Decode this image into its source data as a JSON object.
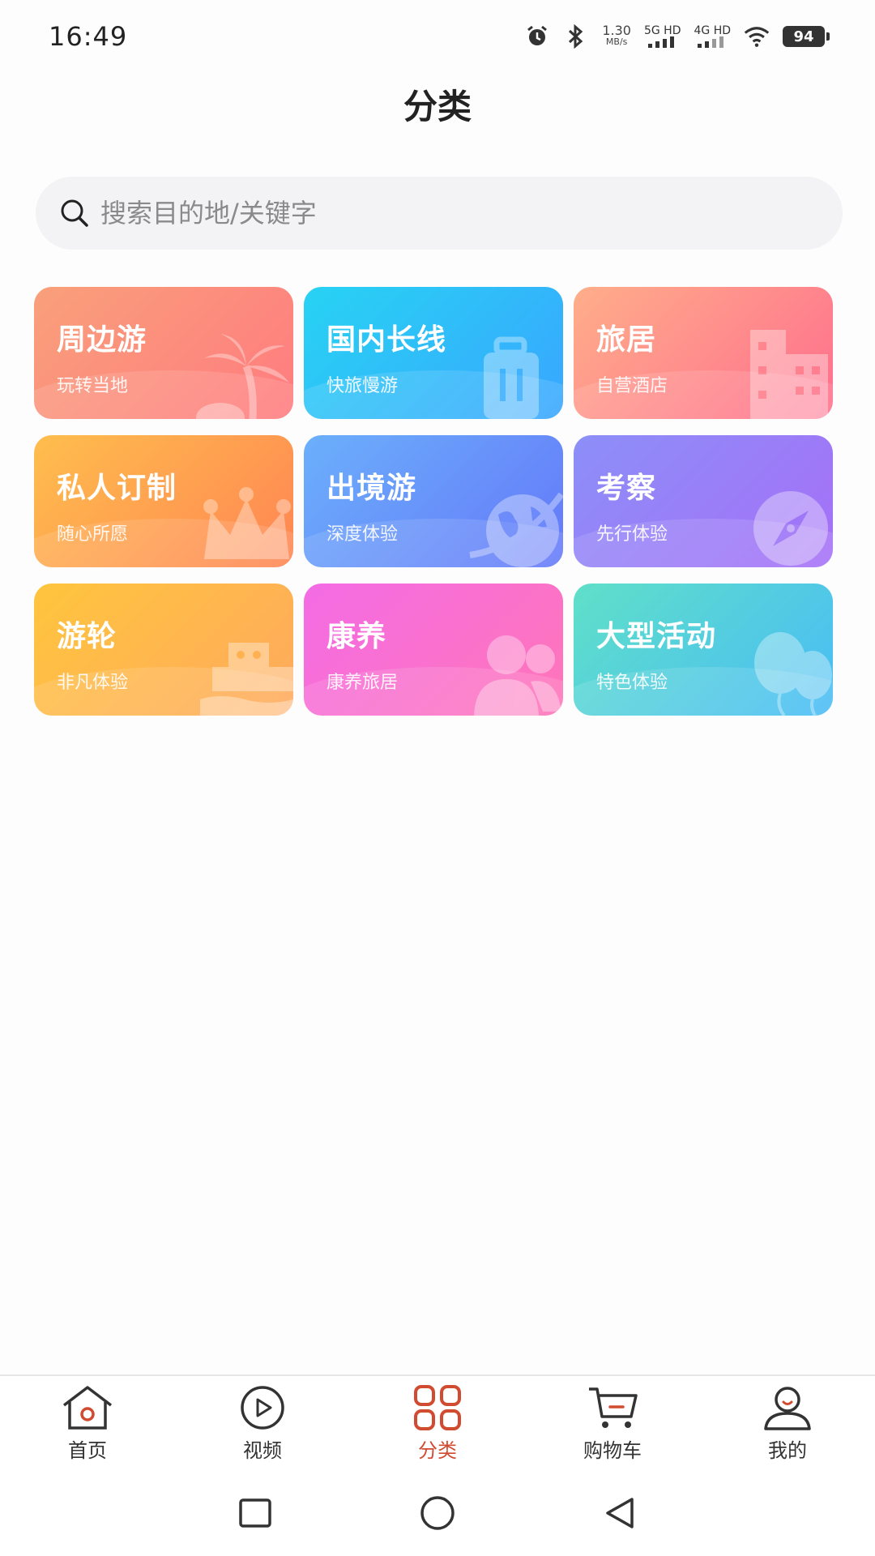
{
  "status_bar": {
    "time": "16:49",
    "net_speed_value": "1.30",
    "net_speed_unit": "MB/s",
    "sim1": "5G HD",
    "sim2": "4G HD",
    "battery": "94",
    "icons": [
      "alarm-icon",
      "bluetooth-icon",
      "signal-icon",
      "wifi-icon",
      "battery-icon"
    ]
  },
  "header": {
    "title": "分类"
  },
  "search": {
    "placeholder": "搜索目的地/关键字",
    "value": ""
  },
  "categories": [
    {
      "title": "周边游",
      "subtitle": "玩转当地",
      "icon": "palm-tree-icon",
      "colors": [
        "#f9a07a",
        "#ff7b80"
      ]
    },
    {
      "title": "国内长线",
      "subtitle": "快旅慢游",
      "icon": "suitcase-icon",
      "colors": [
        "#27d3f3",
        "#39a6ff"
      ]
    },
    {
      "title": "旅居",
      "subtitle": "自营酒店",
      "icon": "building-icon",
      "colors": [
        "#ffae8a",
        "#ff6e8e"
      ]
    },
    {
      "title": "私人订制",
      "subtitle": "随心所愿",
      "icon": "crown-icon",
      "colors": [
        "#ffbe4d",
        "#ff8553"
      ]
    },
    {
      "title": "出境游",
      "subtitle": "深度体验",
      "icon": "globe-icon",
      "colors": [
        "#6bb0fb",
        "#6578fa"
      ]
    },
    {
      "title": "考察",
      "subtitle": "先行体验",
      "icon": "compass-icon",
      "colors": [
        "#8c8ff8",
        "#a66ff7"
      ]
    },
    {
      "title": "游轮",
      "subtitle": "非凡体验",
      "icon": "ship-icon",
      "colors": [
        "#ffc53d",
        "#ffa95e"
      ]
    },
    {
      "title": "康养",
      "subtitle": "康养旅居",
      "icon": "people-icon",
      "colors": [
        "#f46ce5",
        "#ff75b8"
      ]
    },
    {
      "title": "大型活动",
      "subtitle": "特色体验",
      "icon": "balloon-icon",
      "colors": [
        "#5fe0c8",
        "#49bcf6"
      ]
    }
  ],
  "bottom_nav": {
    "active_color": "#d14b31",
    "items": [
      {
        "label": "首页",
        "icon": "home-icon"
      },
      {
        "label": "视频",
        "icon": "video-play-icon"
      },
      {
        "label": "分类",
        "icon": "grid-category-icon",
        "active": true
      },
      {
        "label": "购物车",
        "icon": "cart-icon"
      },
      {
        "label": "我的",
        "icon": "user-icon"
      }
    ]
  },
  "system_nav": {
    "buttons": [
      "recent-apps-icon",
      "home-circle-icon",
      "back-triangle-icon"
    ]
  }
}
